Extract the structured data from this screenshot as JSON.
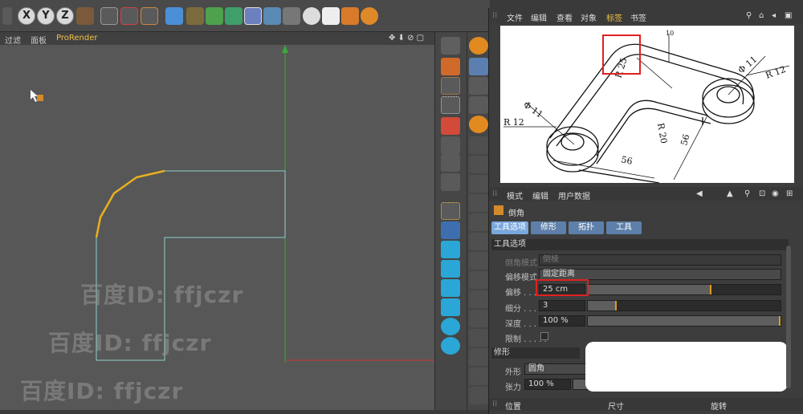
{
  "toolbar": {
    "axis_buttons": [
      "X",
      "Y",
      "Z"
    ]
  },
  "viewport_menu": {
    "filter": "过滤",
    "panel": "面板",
    "prorender": "ProRender"
  },
  "watermarks": [
    "百度ID: ffjczr",
    "百度ID: ffjczr",
    "百度ID: ffjczr"
  ],
  "ref_panel": {
    "menu": [
      "文件",
      "编辑",
      "查看",
      "对象",
      "标签",
      "书签"
    ],
    "active_menu": "标签",
    "drawing_labels": {
      "r25": "R 25",
      "d10": "10",
      "phi11_right": "Φ 11",
      "r12_right": "R 12",
      "phi11_left": "Φ 11",
      "r12_left": "R 12",
      "r20": "R 20",
      "s56_bottom": "56",
      "s56_right": "56"
    }
  },
  "attributes": {
    "menu": [
      "模式",
      "编辑",
      "用户数据"
    ],
    "object_name": "倒角",
    "tabs": [
      "工具选项",
      "修形",
      "拓扑",
      "工具"
    ],
    "active_tab": "工具选项",
    "section_tool": "工具选项",
    "rows": [
      {
        "label": "倒角模式 ...",
        "value": "倒棱",
        "disabled": true
      },
      {
        "label": "偏移模式 ...",
        "value": "固定距离",
        "disabled": false
      },
      {
        "label": "偏移 . . . . .",
        "value": "25 cm",
        "fraction": 0.64
      },
      {
        "label": "细分 . . . . .",
        "value": "3",
        "fraction": 0.15
      },
      {
        "label": "深度 . . . . .",
        "value": "100 %",
        "fraction": 1.0
      },
      {
        "label": "限制 . . . . .",
        "value": ""
      }
    ],
    "section_shape": "修形",
    "shape_rows": [
      {
        "label": "外形",
        "value": "圆角"
      },
      {
        "label": "张力",
        "value": "100 %"
      }
    ],
    "bottom": [
      "位置",
      "尺寸",
      "旋转"
    ]
  },
  "colors": {
    "accent_yellow": "#f0c040",
    "highlight_red": "#e02020",
    "spline_cyan": "#8ecfc9",
    "bevel_yellow": "#e8b020",
    "tab_blue": "#7aa7dc"
  }
}
